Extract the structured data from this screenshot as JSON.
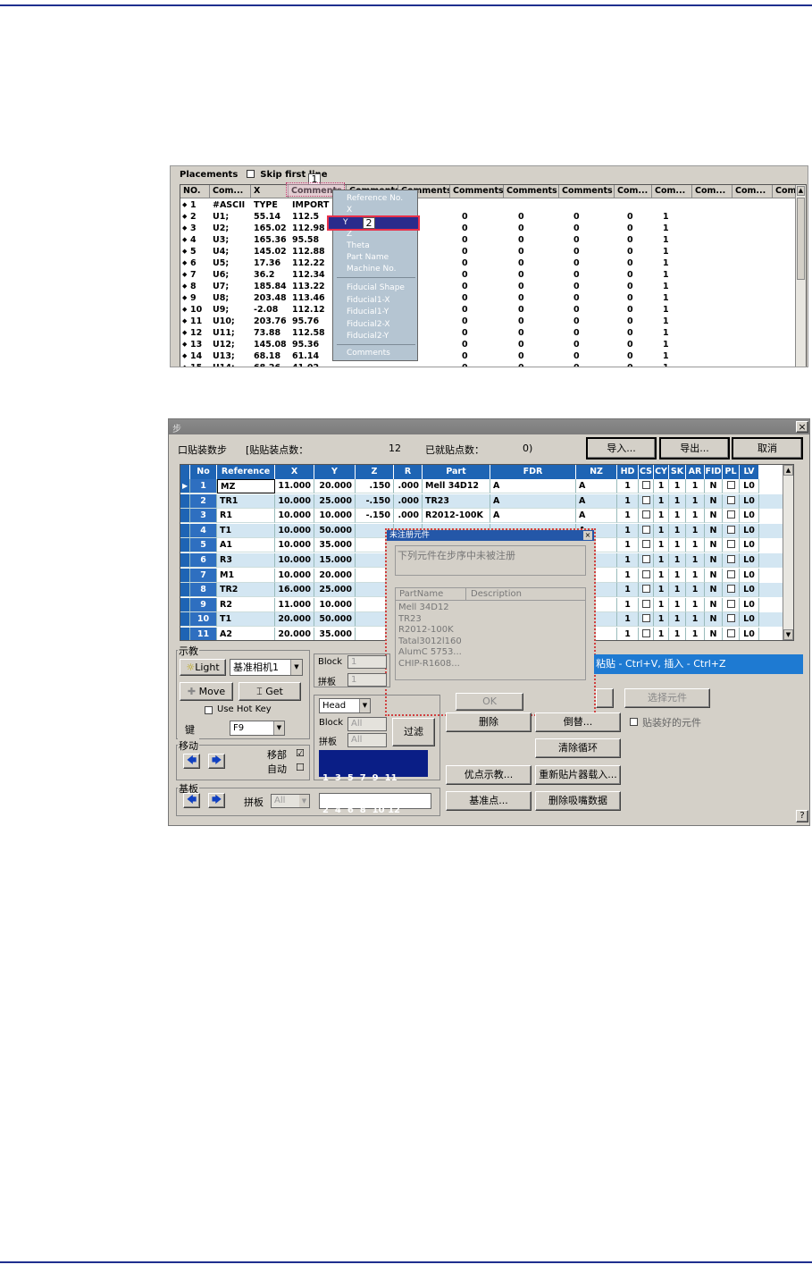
{
  "shot1": {
    "placements_label": "Placements",
    "skip_first_line": "Skip first line",
    "callout1": "1",
    "callout2": "2",
    "headers": [
      "NO.",
      "Com...",
      "X",
      "Comments",
      "Comments",
      "Comments",
      "Comments",
      "Comments",
      "Comments",
      "Com...",
      "Com...",
      "Com...",
      "Com...",
      "Com"
    ],
    "rows": [
      {
        "no": "1",
        "ref": "#ASCII",
        "x": "TYPE",
        "y": "IMPORT"
      },
      {
        "no": "2",
        "ref": "U1;",
        "x": "55.14",
        "y": "112.5"
      },
      {
        "no": "3",
        "ref": "U2;",
        "x": "165.02",
        "y": "112.98"
      },
      {
        "no": "4",
        "ref": "U3;",
        "x": "165.36",
        "y": "95.58"
      },
      {
        "no": "5",
        "ref": "U4;",
        "x": "145.02",
        "y": "112.88"
      },
      {
        "no": "6",
        "ref": "U5;",
        "x": "17.36",
        "y": "112.22"
      },
      {
        "no": "7",
        "ref": "U6;",
        "x": "36.2",
        "y": "112.34"
      },
      {
        "no": "8",
        "ref": "U7;",
        "x": "185.84",
        "y": "113.22"
      },
      {
        "no": "9",
        "ref": "U8;",
        "x": "203.48",
        "y": "113.46"
      },
      {
        "no": "10",
        "ref": "U9;",
        "x": "-2.08",
        "y": "112.12"
      },
      {
        "no": "11",
        "ref": "U10;",
        "x": "203.76",
        "y": "95.76"
      },
      {
        "no": "12",
        "ref": "U11;",
        "x": "73.88",
        "y": "112.58"
      },
      {
        "no": "13",
        "ref": "U12;",
        "x": "145.08",
        "y": "95.36"
      },
      {
        "no": "14",
        "ref": "U13;",
        "x": "68.18",
        "y": "61.14"
      },
      {
        "no": "15",
        "ref": "U14;",
        "x": "68.26",
        "y": "41.02"
      }
    ],
    "zero": "0",
    "one": "1",
    "menu": {
      "items": [
        "Reference No.",
        "X",
        "Y",
        "Z",
        "Theta",
        "Part Name",
        "Machine No.",
        "Fiducial Shape",
        "Fiducial1-X",
        "Fiducial1-Y",
        "Fiducial2-X",
        "Fiducial2-Y",
        "Comments"
      ]
    }
  },
  "shot2": {
    "title": "步",
    "close": "×",
    "total_label": "口贴装数步",
    "pad_label": "[贴贴装点数：",
    "pad_value": "12",
    "imported_label": "已就贴点数：",
    "imported_value": "0)",
    "import_btn": "导入...",
    "export_btn": "导出...",
    "cancel_btn": "取消",
    "columns": [
      "No",
      "Reference",
      "X",
      "Y",
      "Z",
      "R",
      "Part",
      "FDR",
      "NZ",
      "HD",
      "CS",
      "CY",
      "SK",
      "AR",
      "FID",
      "PL",
      "LV"
    ],
    "rows": [
      {
        "no": "1",
        "ref": "MZ",
        "x": "11.000",
        "y": "20.000",
        "z": ".150",
        "r": ".000",
        "part": "Mell 34D12",
        "fdr": "A",
        "nz": "A",
        "hd": "1",
        "cy": "1",
        "sk": "1",
        "fid": "N",
        "lv": "L0"
      },
      {
        "no": "2",
        "ref": "TR1",
        "x": "10.000",
        "y": "25.000",
        "z": "-.150",
        "r": ".000",
        "part": "TR23",
        "fdr": "A",
        "nz": "A",
        "hd": "1",
        "cy": "1",
        "sk": "1",
        "fid": "N",
        "lv": "L0"
      },
      {
        "no": "3",
        "ref": "R1",
        "x": "10.000",
        "y": "10.000",
        "z": "-.150",
        "r": ".000",
        "part": "R2012-100K",
        "fdr": "A",
        "nz": "A",
        "hd": "1",
        "cy": "1",
        "sk": "1",
        "fid": "N",
        "lv": "L0"
      },
      {
        "no": "4",
        "ref": "T1",
        "x": "10.000",
        "y": "50.000",
        "z": "",
        "r": "",
        "part": "",
        "fdr": "",
        "nz": "A",
        "hd": "1",
        "cy": "1",
        "sk": "1",
        "fid": "N",
        "lv": "L0"
      },
      {
        "no": "5",
        "ref": "A1",
        "x": "10.000",
        "y": "35.000",
        "z": "",
        "r": "",
        "part": "",
        "fdr": "",
        "nz": "A",
        "hd": "1",
        "cy": "1",
        "sk": "1",
        "fid": "N",
        "lv": "L0"
      },
      {
        "no": "6",
        "ref": "R3",
        "x": "10.000",
        "y": "15.000",
        "z": "",
        "r": "",
        "part": "",
        "fdr": "",
        "nz": "A",
        "hd": "1",
        "cy": "1",
        "sk": "1",
        "fid": "N",
        "lv": "L0"
      },
      {
        "no": "7",
        "ref": "M1",
        "x": "10.000",
        "y": "20.000",
        "z": "",
        "r": "",
        "part": "",
        "fdr": "",
        "nz": "A",
        "hd": "1",
        "cy": "1",
        "sk": "1",
        "fid": "N",
        "lv": "L0"
      },
      {
        "no": "8",
        "ref": "TR2",
        "x": "16.000",
        "y": "25.000",
        "z": "",
        "r": "",
        "part": "",
        "fdr": "",
        "nz": "A",
        "hd": "1",
        "cy": "1",
        "sk": "1",
        "fid": "N",
        "lv": "L0"
      },
      {
        "no": "9",
        "ref": "R2",
        "x": "11.000",
        "y": "10.000",
        "z": "",
        "r": "",
        "part": "",
        "fdr": "",
        "nz": "A",
        "hd": "1",
        "cy": "1",
        "sk": "1",
        "fid": "N",
        "lv": "L0"
      },
      {
        "no": "10",
        "ref": "T1",
        "x": "20.000",
        "y": "50.000",
        "z": "",
        "r": "",
        "part": "",
        "fdr": "",
        "nz": "A",
        "hd": "1",
        "cy": "1",
        "sk": "1",
        "fid": "N",
        "lv": "L0"
      },
      {
        "no": "11",
        "ref": "A2",
        "x": "20.000",
        "y": "35.000",
        "z": "",
        "r": "",
        "part": "",
        "fdr": "",
        "nz": "A",
        "hd": "1",
        "cy": "1",
        "sk": "1",
        "fid": "N",
        "lv": "L0"
      }
    ],
    "dialog": {
      "title": "未注册元件",
      "message": "下列元件在步序中未被注册",
      "col_part": "PartName",
      "col_desc": "Description",
      "parts": [
        "Mell 34D12",
        "TR23",
        "R2012-100K",
        "Tatal3012l160",
        "AlumC 5753...",
        "CHIP-R1608..."
      ],
      "ok": "OK"
    },
    "teach_group": "示教",
    "light_btn": "Light",
    "light_select": "基准相机1",
    "move_btn": "Move",
    "get_btn": "Get",
    "use_hot_key": "Use Hot Key",
    "key_label": "键",
    "key_value": "F9",
    "move_group": "移动",
    "all_label": "移部",
    "auto_label": "自动",
    "board_group": "基板",
    "panel_label": "拼板",
    "panel_value": "All",
    "block_label": "Block",
    "block_value": "1",
    "panel2_label": "拼板",
    "panel2_value": "1",
    "head_select": "Head",
    "block2_label": "Block",
    "block2_value": "All",
    "panel3_label": "拼板",
    "panel3_value": "All",
    "filter_btn": "过滤",
    "nums_row1": "1  3  5  7  9  11",
    "nums_row2": "2  4  6  8  10 12",
    "delete_btn": "删除",
    "replace_btn": "倒替...",
    "clear_loop_btn": "清除循环",
    "opt_btn": "优点示教...",
    "reload_btn": "重新贴片器载入...",
    "base_btn": "基准点...",
    "del_nozzle_btn": "删除吸嘴数据",
    "paste_hint": "粘贴 - Ctrl+V, 插入 - Ctrl+Z",
    "select_parts_btn": "选择元件",
    "select_check": "贴装好的元件",
    "help": "?"
  }
}
